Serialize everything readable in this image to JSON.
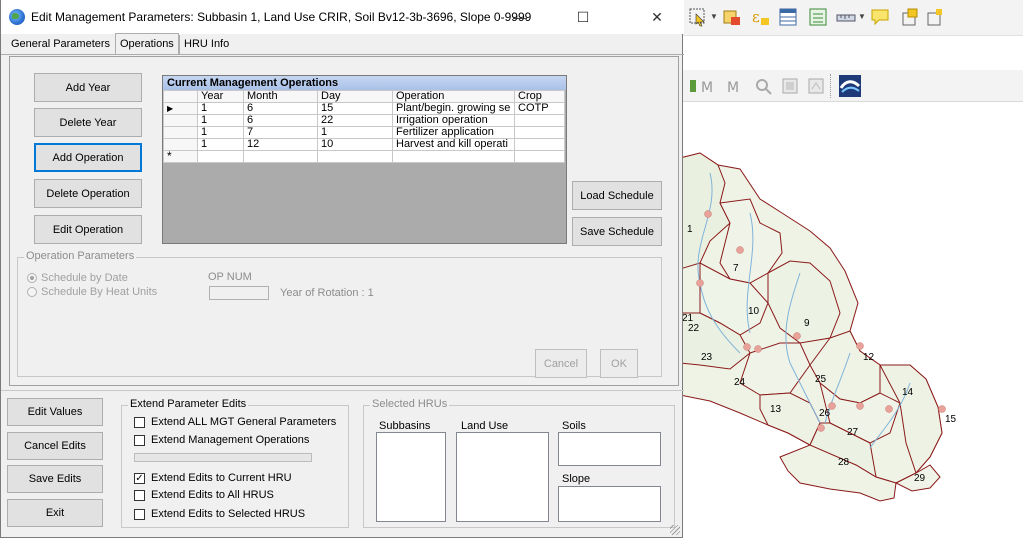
{
  "window": {
    "title": "Edit Management Parameters: Subbasin 1, Land Use CRIR, Soil Bv12-3b-3696, Slope 0-9999",
    "minimize": "—",
    "maximize": "☐",
    "close": "✕"
  },
  "tabs": [
    "General Parameters",
    "Operations",
    "HRU Info"
  ],
  "buttons": {
    "add_year": "Add Year",
    "delete_year": "Delete Year",
    "add_operation": "Add Operation",
    "delete_operation": "Delete Operation",
    "edit_operation": "Edit Operation",
    "load_schedule": "Load Schedule",
    "save_schedule": "Save Schedule",
    "cancel": "Cancel",
    "ok": "OK",
    "edit_values": "Edit Values",
    "cancel_edits": "Cancel Edits",
    "save_edits": "Save Edits",
    "exit": "Exit"
  },
  "grid": {
    "caption": "Current Management Operations",
    "columns": [
      "Year",
      "Month",
      "Day",
      "Operation",
      "Crop"
    ],
    "rows": [
      {
        "year": "1",
        "month": "6",
        "day": "15",
        "operation": "Plant/begin. growing se",
        "crop": "COTP",
        "current": true
      },
      {
        "year": "1",
        "month": "6",
        "day": "22",
        "operation": "Irrigation operation",
        "crop": ""
      },
      {
        "year": "1",
        "month": "7",
        "day": "1",
        "operation": "Fertilizer application",
        "crop": ""
      },
      {
        "year": "1",
        "month": "12",
        "day": "10",
        "operation": "Harvest and kill operati",
        "crop": ""
      }
    ],
    "new_row_marker": "*",
    "current_row_marker": "▶"
  },
  "operation_parameters": {
    "label": "Operation Parameters",
    "schedule_by_date": "Schedule by Date",
    "schedule_by_heat_units": "Schedule By Heat Units",
    "op_num_label": "OP NUM",
    "year_of_rotation": "Year of Rotation : 1"
  },
  "extend": {
    "label": "Extend Parameter Edits",
    "options": [
      {
        "label": "Extend ALL MGT General Parameters",
        "checked": false
      },
      {
        "label": "Extend Management Operations",
        "checked": false
      },
      {
        "label": "Extend Edits to Current HRU",
        "checked": true
      },
      {
        "label": "Extend Edits to All HRUS",
        "checked": false
      },
      {
        "label": "Extend Edits to Selected HRUS",
        "checked": false
      }
    ]
  },
  "selected_hrus": {
    "label": "Selected HRUs",
    "subbasins": "Subbasins",
    "land_use": "Land Use",
    "soils": "Soils",
    "slope": "Slope"
  },
  "map": {
    "subbasin_labels": [
      "1",
      "7",
      "10",
      "9",
      "21",
      "22",
      "23",
      "12",
      "24",
      "25",
      "14",
      "13",
      "26",
      "15",
      "27",
      "28",
      "29"
    ]
  },
  "colors": {
    "map_fill": "#eef3e6",
    "map_border": "#8b1a1a",
    "outlet": "#e8a29a",
    "river": "#7fb3d9",
    "focus": "#0078d7",
    "caption": "#b7ccec"
  }
}
